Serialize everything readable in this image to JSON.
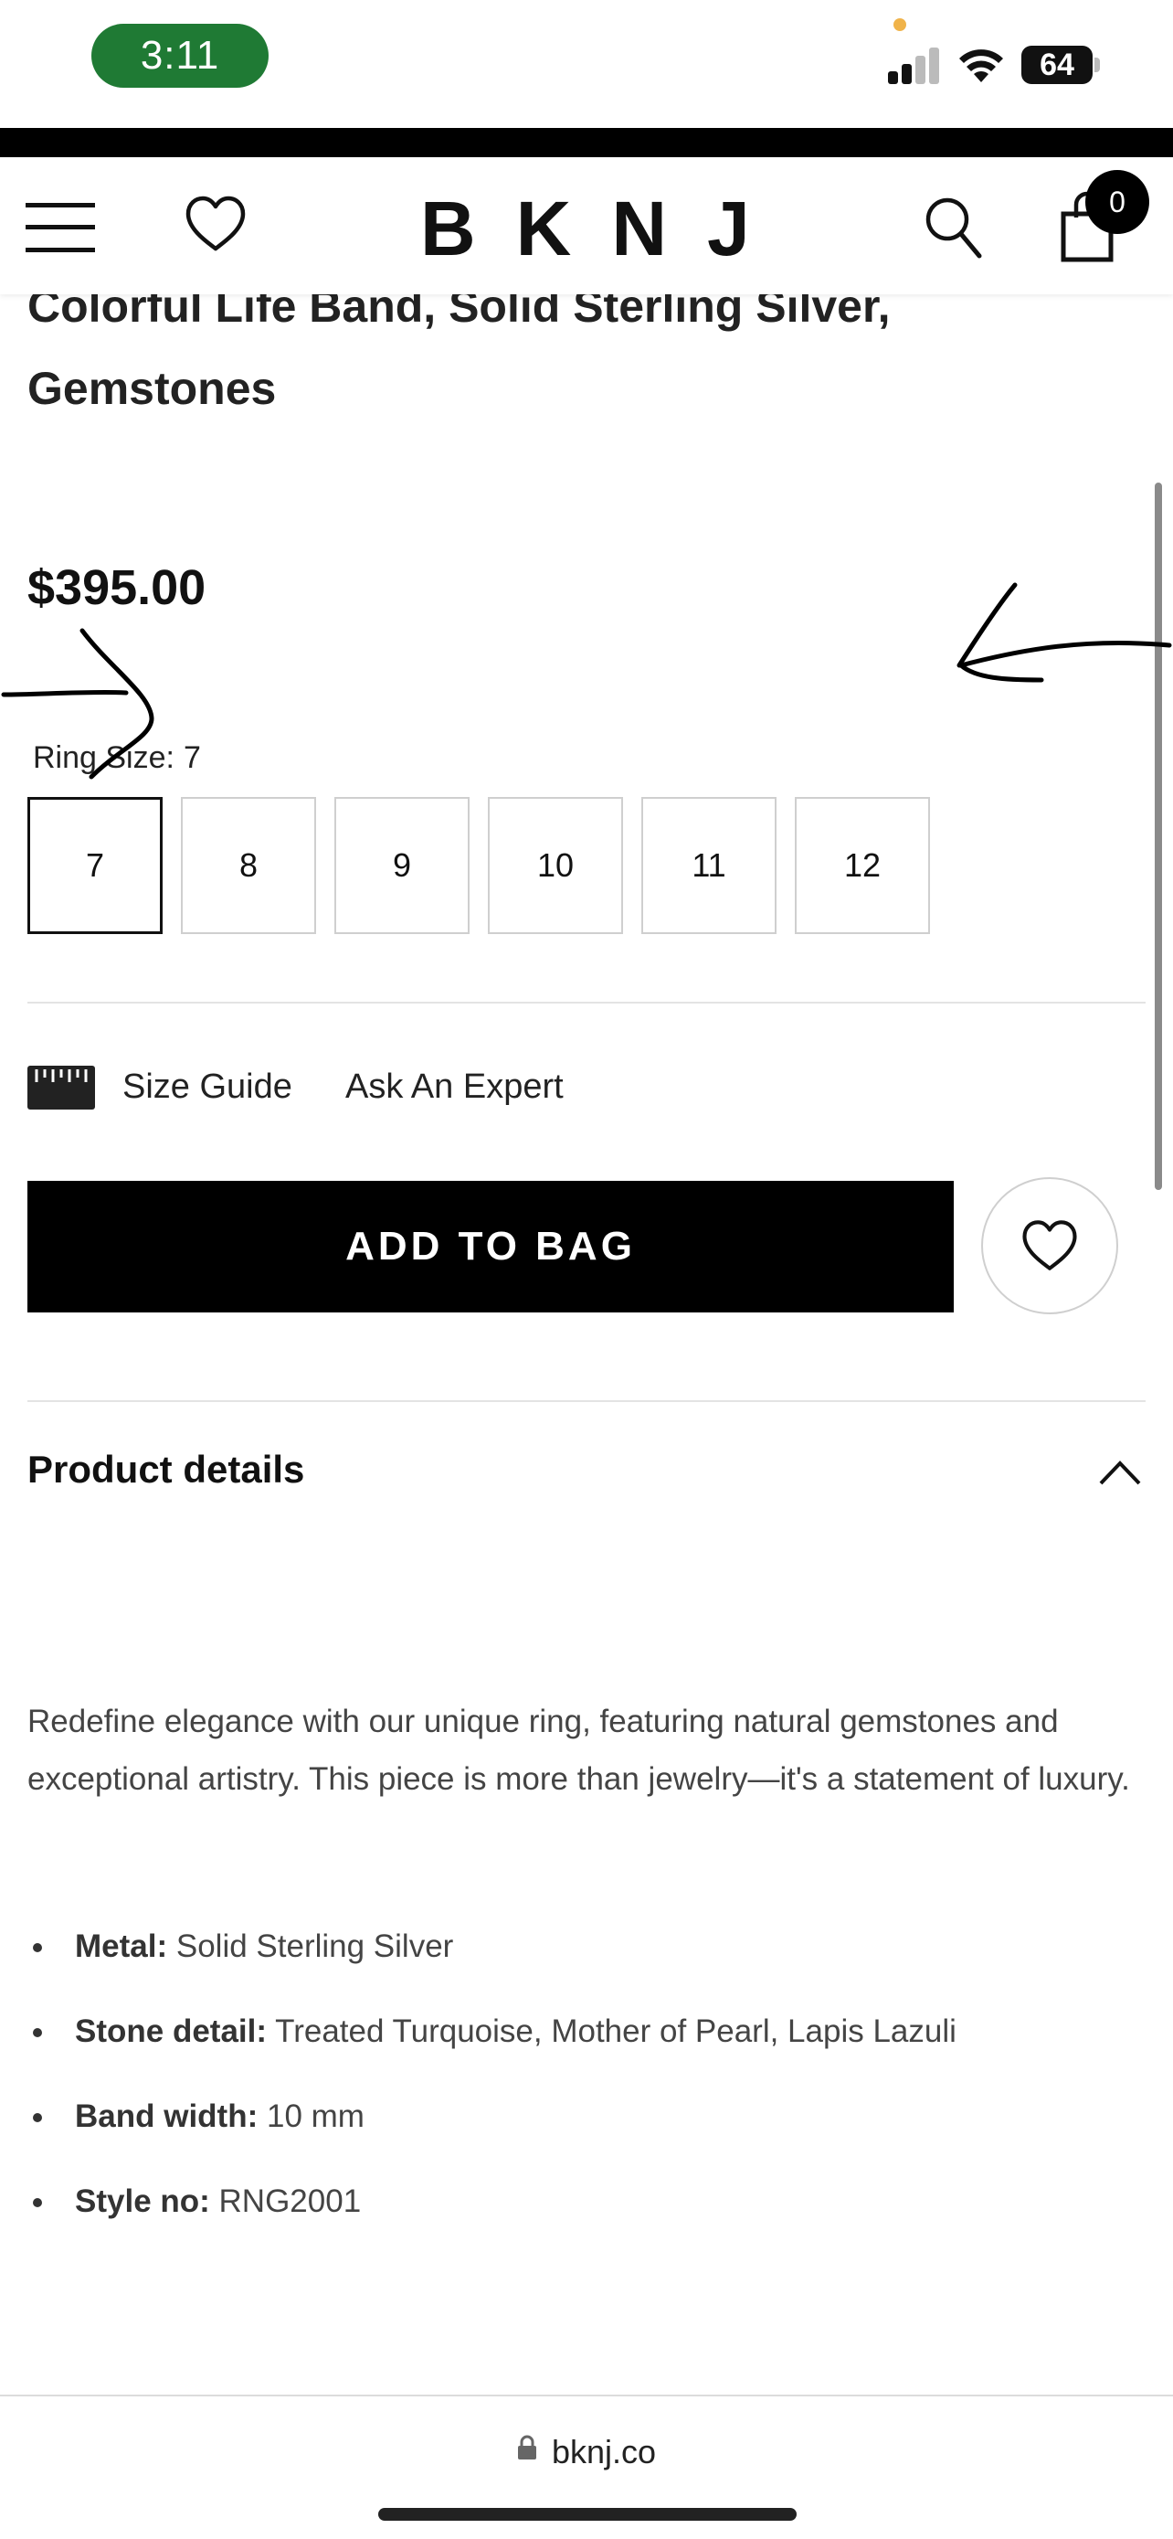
{
  "status_bar": {
    "time": "3:11",
    "battery": "64",
    "colors": {
      "time_pill": "#1f7a34",
      "mic_dot": "#f0b34a"
    }
  },
  "header": {
    "logo": "BKNJ",
    "cart_count": "0",
    "icons": [
      "menu-icon",
      "heart-icon",
      "search-icon",
      "bag-icon"
    ]
  },
  "product": {
    "title": "Colorful Life Band, Solid Sterling Silver, Gemstones",
    "price": "$395.00",
    "ring_size_label": "Ring Size:",
    "ring_size_value": "7",
    "sizes": [
      "7",
      "8",
      "9",
      "10",
      "11",
      "12"
    ],
    "selected_size": "7",
    "size_guide": "Size Guide",
    "ask_expert": "Ask An Expert",
    "add_to_bag": "ADD TO BAG"
  },
  "details": {
    "heading": "Product details",
    "description": "Redefine elegance with our unique ring, featuring natural gemstones and exceptional artistry. This piece is more than jewelry—it's a statement of luxury.",
    "specs": [
      {
        "key": "Metal:",
        "value": "Solid Sterling Silver"
      },
      {
        "key": "Stone detail:",
        "value": "Treated Turquoise, Mother of Pearl, Lapis Lazuli"
      },
      {
        "key": "Band width:",
        "value": "10 mm"
      },
      {
        "key": "Style no:",
        "value": "RNG2001"
      }
    ]
  },
  "browser": {
    "url": "bknj.co"
  }
}
